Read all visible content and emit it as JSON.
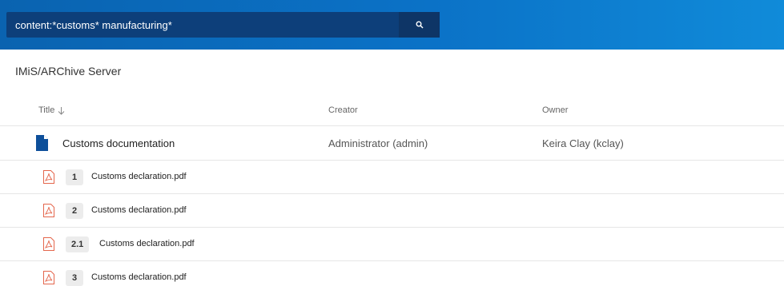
{
  "search": {
    "value": "content:*customs* manufacturing*"
  },
  "breadcrumb": "IMiS/ARChive Server",
  "columns": {
    "title": "Title",
    "title_sort_icon": "arrow-down-icon",
    "creator": "Creator",
    "owner": "Owner"
  },
  "folder": {
    "icon": "document-icon",
    "title": "Customs documentation",
    "creator": "Administrator (admin)",
    "owner": "Keira Clay (kclay)"
  },
  "files": [
    {
      "icon": "pdf-icon",
      "version": "1",
      "name": "Customs declaration.pdf"
    },
    {
      "icon": "pdf-icon",
      "version": "2",
      "name": "Customs declaration.pdf"
    },
    {
      "icon": "pdf-icon",
      "version": "2.1",
      "name": "Customs declaration.pdf"
    },
    {
      "icon": "pdf-icon",
      "version": "3",
      "name": "Customs declaration.pdf"
    }
  ],
  "colors": {
    "topbar": "#0b72c7",
    "searchbox": "#0d3f7a",
    "folder_icon": "#0d4f9a",
    "pdf_icon": "#e4664c"
  }
}
